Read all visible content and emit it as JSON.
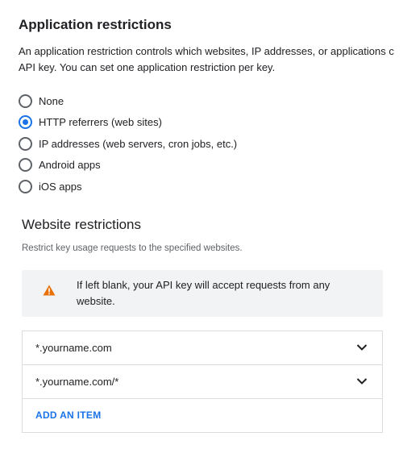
{
  "section": {
    "title": "Application restrictions",
    "description_line1": "An application restriction controls which websites, IP addresses, or applications c",
    "description_line2": "API key. You can set one application restriction per key."
  },
  "restriction_options": [
    {
      "label": "None",
      "selected": false
    },
    {
      "label": "HTTP referrers (web sites)",
      "selected": true
    },
    {
      "label": "IP addresses (web servers, cron jobs, etc.)",
      "selected": false
    },
    {
      "label": "Android apps",
      "selected": false
    },
    {
      "label": "iOS apps",
      "selected": false
    }
  ],
  "website_restrictions": {
    "title": "Website restrictions",
    "description": "Restrict key usage requests to the specified websites.",
    "warning_icon": "warning-triangle-icon",
    "warning_text": "If left blank, your API key will accept requests from any website.",
    "items": [
      {
        "value": "*.yourname.com"
      },
      {
        "value": "*.yourname.com/*"
      }
    ],
    "add_item_label": "ADD AN ITEM"
  },
  "colors": {
    "accent": "#1a73e8",
    "warning": "#e8710a",
    "text": "#202124",
    "secondary_text": "#5f6368",
    "border": "#dadce0",
    "warning_background": "#f1f3f4"
  }
}
